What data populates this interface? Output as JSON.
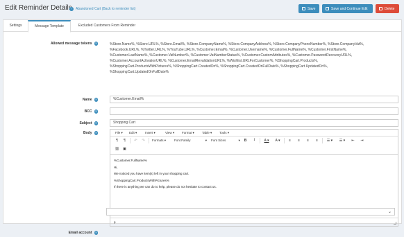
{
  "header": {
    "title": "Edit Reminder Details",
    "back_link": "Abandoned Cart (Back to reminder list)",
    "save_label": "Save",
    "save_continue_label": "Save and Continue Edit",
    "delete_label": "Delete",
    "colors": {
      "primary": "#3c8dbc",
      "danger": "#dd4b39"
    }
  },
  "tabs": [
    {
      "label": "Settings"
    },
    {
      "label": "Message Template"
    },
    {
      "label": "Excluded Customers From Reminder"
    }
  ],
  "form": {
    "tokens_label": "Allowed message tokens",
    "tokens_lines": [
      "%Store.Name%, %Store.URL%, %Store.Email%, %Store.CompanyName%, %Store.CompanyAddress%, %Store.CompanyPhoneNumber%, %Store.CompanyVat%,",
      "%Facebook.URL%, %Twitter.URL%, %YouTube.URL%, %Customer.Email%, %Customer.Username%, %Customer.FullName%, %Customer.FirstName%,",
      "%Customer.LastName%, %Customer.VatNumber%, %Customer.VatNumberStatus%, %Customer.CustomAttributes%, %Customer.PasswordRecoveryURL%,",
      "%Customer.AccountActivationURL%, %Customer.EmailRevalidationURL%, %Wishlist.URLForCustomer%, %ShoppingCart.Products%,",
      "%ShoppingCart.ProductsWithPictures%, %ShoppingCart.CreatedOn%, %ShoppingCart.CreatedOnFullDate%, %ShoppingCart.UpdatedOn%,",
      "%ShoppingCart.UpdatedOnFullDate%"
    ],
    "name_label": "Name",
    "name_value": "%Customer.Email%",
    "bcc_label": "BCC",
    "bcc_value": "",
    "subject_label": "Subject",
    "subject_value": "Shopping Cart",
    "body_label": "Body",
    "email_account_label": "Email account",
    "email_account_value": ""
  },
  "editor": {
    "menu": [
      "File",
      "Edit",
      "Insert",
      "View",
      "Format",
      "Table",
      "Tools"
    ],
    "formats": "Formats",
    "font_family": "Font Family",
    "font_sizes": "Font Sizes",
    "content_lines": [
      "%Customer.FullName%",
      "Hi,",
      "We noticed you have item(s) left in your shopping cart.",
      "%ShoppingCart.ProductsWithPictures%",
      "If there is anything we can do to help, please do not hesitate to contact us."
    ],
    "status_path": "p"
  }
}
